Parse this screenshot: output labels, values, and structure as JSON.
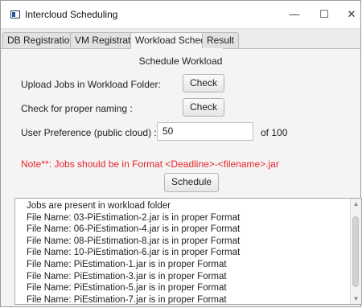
{
  "window": {
    "title": "Intercloud Scheduling",
    "minimize_glyph": "—",
    "maximize_glyph": "☐",
    "close_glyph": "✕"
  },
  "tabs": [
    {
      "label": "DB Registration"
    },
    {
      "label": "VM Registration"
    },
    {
      "label": "Workload Schedule",
      "active": true
    },
    {
      "label": "Result"
    }
  ],
  "panel": {
    "title": "Schedule Workload",
    "upload_label": "Upload Jobs in Workload Folder:",
    "upload_button": "Check",
    "naming_label": "Check for proper naming :",
    "naming_button": "Check",
    "preference_label": "User Preference (public cloud) :",
    "preference_value": "50",
    "preference_suffix": "of 100",
    "note": "Note**: Jobs should be in Format <Deadline>-<filename>.jar",
    "schedule_button": "Schedule"
  },
  "log": {
    "lines": [
      "Jobs are present in workload folder",
      "File Name: 03-PiEstimation-2.jar is in proper Format",
      "File Name: 06-PiEstimation-4.jar is in proper Format",
      "File Name: 08-PiEstimation-8.jar is in proper Format",
      "File Name: 10-PiEstimation-6.jar is in proper Format",
      "File Name: PiEstimation-1.jar is in proper Format",
      "File Name: PiEstimation-3.jar is in proper Format",
      "File Name: PiEstimation-5.jar is in proper Format",
      "File Name: PiEstimation-7.jar is in proper Format"
    ]
  },
  "colors": {
    "note_red": "#e8242b",
    "panel_bg": "#f4f4f4"
  }
}
